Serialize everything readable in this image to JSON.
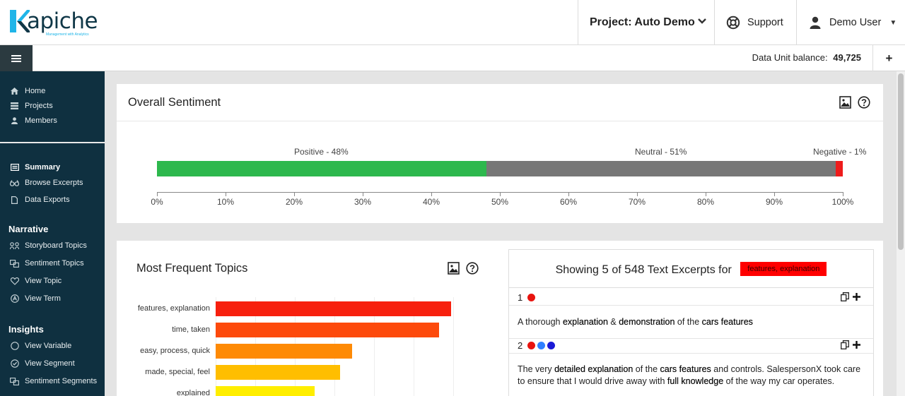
{
  "app": {
    "logo_text": "apiche",
    "logo_tagline": "Management with Analytics",
    "project_label": "Project: Auto Demo",
    "support_label": "Support",
    "user_label": "Demo User",
    "balance_label": "Data Unit balance:",
    "balance_value": "49,725"
  },
  "sidebar": {
    "top_items": [
      {
        "label": "Home",
        "icon": "home-icon"
      },
      {
        "label": "Projects",
        "icon": "list-icon"
      },
      {
        "label": "Members",
        "icon": "user-icon"
      }
    ],
    "main_items": [
      {
        "label": "Summary",
        "icon": "summary-icon",
        "active": true
      },
      {
        "label": "Browse Excerpts",
        "icon": "binoculars-icon"
      },
      {
        "label": "Data Exports",
        "icon": "file-icon"
      }
    ],
    "narrative_heading": "Narrative",
    "narrative_items": [
      {
        "label": "Storyboard Topics",
        "icon": "storyboard-icon"
      },
      {
        "label": "Sentiment Topics",
        "icon": "sentiment-icon"
      },
      {
        "label": "View Topic",
        "icon": "heart-icon"
      },
      {
        "label": "View Term",
        "icon": "term-icon"
      }
    ],
    "insights_heading": "Insights",
    "insights_items": [
      {
        "label": "View Variable",
        "icon": "circle-icon"
      },
      {
        "label": "View Segment",
        "icon": "segment-icon"
      },
      {
        "label": "Sentiment Segments",
        "icon": "sentiment-segments-icon"
      }
    ]
  },
  "sentiment": {
    "title": "Overall Sentiment",
    "labels": {
      "positive": "Positive - 48%",
      "neutral": "Neutral - 51%",
      "negative": "Negative - 1%"
    },
    "chart_data": {
      "type": "bar",
      "orientation": "horizontal-stacked",
      "categories": [
        "Positive",
        "Neutral",
        "Negative"
      ],
      "values": [
        48,
        51,
        1
      ],
      "colors": [
        "#2db84d",
        "#777777",
        "#ee1c1c"
      ],
      "xlim": [
        0,
        100
      ],
      "ticks": [
        "0%",
        "10%",
        "20%",
        "30%",
        "40%",
        "50%",
        "60%",
        "70%",
        "80%",
        "90%",
        "100%"
      ]
    }
  },
  "topics": {
    "title": "Most Frequent Topics",
    "chart_data": {
      "type": "bar",
      "orientation": "horizontal",
      "categories": [
        "features, explanation",
        "time, taken",
        "easy, process, quick",
        "made, special, feel",
        "explained"
      ],
      "values": [
        100,
        95,
        58,
        53,
        42
      ],
      "colors": [
        "#f7200e",
        "#fd4a0c",
        "#fe8a05",
        "#ffbe00",
        "#ffee00"
      ]
    }
  },
  "excerpts": {
    "showing_prefix": "Showing",
    "shown": "5",
    "of": "of",
    "total": "548",
    "suffix": "Text Excerpts for",
    "badge": "features, explanation",
    "items": [
      {
        "num": "1",
        "dots": [
          "#e8140f"
        ],
        "text_html": "A thorough <b>explanation</b> &amp; <b>demonstration</b> of the <b>cars features</b>"
      },
      {
        "num": "2",
        "dots": [
          "#e8140f",
          "#2f80ff",
          "#1a1ad6"
        ],
        "text_html": "The very <b>detailed explanation</b> of the <b>cars features</b> and controls. SalespersonX took care to ensure that I would drive away with <b>full knowledge</b> of the way my car operates."
      }
    ]
  }
}
